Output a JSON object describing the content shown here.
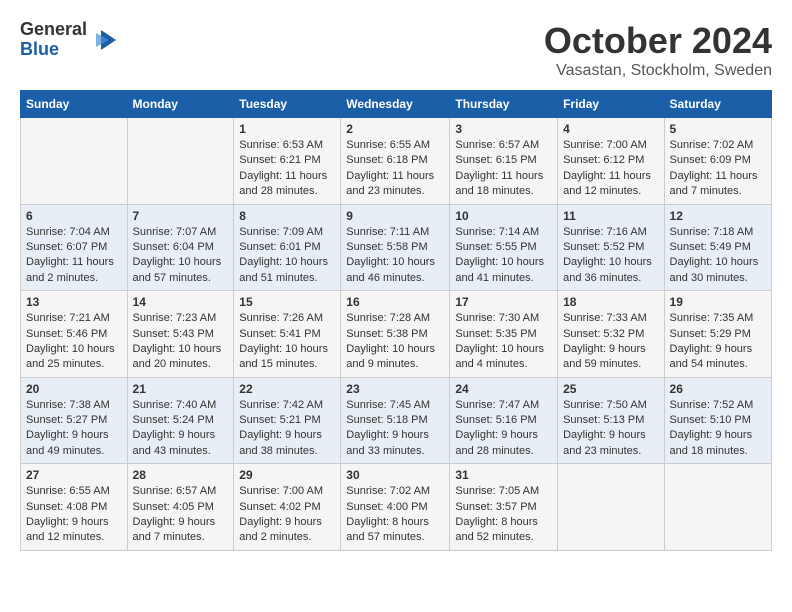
{
  "logo": {
    "general": "General",
    "blue": "Blue"
  },
  "title": "October 2024",
  "location": "Vasastan, Stockholm, Sweden",
  "days_header": [
    "Sunday",
    "Monday",
    "Tuesday",
    "Wednesday",
    "Thursday",
    "Friday",
    "Saturday"
  ],
  "weeks": [
    [
      {
        "day": "",
        "info": ""
      },
      {
        "day": "",
        "info": ""
      },
      {
        "day": "1",
        "sunrise": "Sunrise: 6:53 AM",
        "sunset": "Sunset: 6:21 PM",
        "daylight": "Daylight: 11 hours and 28 minutes."
      },
      {
        "day": "2",
        "sunrise": "Sunrise: 6:55 AM",
        "sunset": "Sunset: 6:18 PM",
        "daylight": "Daylight: 11 hours and 23 minutes."
      },
      {
        "day": "3",
        "sunrise": "Sunrise: 6:57 AM",
        "sunset": "Sunset: 6:15 PM",
        "daylight": "Daylight: 11 hours and 18 minutes."
      },
      {
        "day": "4",
        "sunrise": "Sunrise: 7:00 AM",
        "sunset": "Sunset: 6:12 PM",
        "daylight": "Daylight: 11 hours and 12 minutes."
      },
      {
        "day": "5",
        "sunrise": "Sunrise: 7:02 AM",
        "sunset": "Sunset: 6:09 PM",
        "daylight": "Daylight: 11 hours and 7 minutes."
      }
    ],
    [
      {
        "day": "6",
        "sunrise": "Sunrise: 7:04 AM",
        "sunset": "Sunset: 6:07 PM",
        "daylight": "Daylight: 11 hours and 2 minutes."
      },
      {
        "day": "7",
        "sunrise": "Sunrise: 7:07 AM",
        "sunset": "Sunset: 6:04 PM",
        "daylight": "Daylight: 10 hours and 57 minutes."
      },
      {
        "day": "8",
        "sunrise": "Sunrise: 7:09 AM",
        "sunset": "Sunset: 6:01 PM",
        "daylight": "Daylight: 10 hours and 51 minutes."
      },
      {
        "day": "9",
        "sunrise": "Sunrise: 7:11 AM",
        "sunset": "Sunset: 5:58 PM",
        "daylight": "Daylight: 10 hours and 46 minutes."
      },
      {
        "day": "10",
        "sunrise": "Sunrise: 7:14 AM",
        "sunset": "Sunset: 5:55 PM",
        "daylight": "Daylight: 10 hours and 41 minutes."
      },
      {
        "day": "11",
        "sunrise": "Sunrise: 7:16 AM",
        "sunset": "Sunset: 5:52 PM",
        "daylight": "Daylight: 10 hours and 36 minutes."
      },
      {
        "day": "12",
        "sunrise": "Sunrise: 7:18 AM",
        "sunset": "Sunset: 5:49 PM",
        "daylight": "Daylight: 10 hours and 30 minutes."
      }
    ],
    [
      {
        "day": "13",
        "sunrise": "Sunrise: 7:21 AM",
        "sunset": "Sunset: 5:46 PM",
        "daylight": "Daylight: 10 hours and 25 minutes."
      },
      {
        "day": "14",
        "sunrise": "Sunrise: 7:23 AM",
        "sunset": "Sunset: 5:43 PM",
        "daylight": "Daylight: 10 hours and 20 minutes."
      },
      {
        "day": "15",
        "sunrise": "Sunrise: 7:26 AM",
        "sunset": "Sunset: 5:41 PM",
        "daylight": "Daylight: 10 hours and 15 minutes."
      },
      {
        "day": "16",
        "sunrise": "Sunrise: 7:28 AM",
        "sunset": "Sunset: 5:38 PM",
        "daylight": "Daylight: 10 hours and 9 minutes."
      },
      {
        "day": "17",
        "sunrise": "Sunrise: 7:30 AM",
        "sunset": "Sunset: 5:35 PM",
        "daylight": "Daylight: 10 hours and 4 minutes."
      },
      {
        "day": "18",
        "sunrise": "Sunrise: 7:33 AM",
        "sunset": "Sunset: 5:32 PM",
        "daylight": "Daylight: 9 hours and 59 minutes."
      },
      {
        "day": "19",
        "sunrise": "Sunrise: 7:35 AM",
        "sunset": "Sunset: 5:29 PM",
        "daylight": "Daylight: 9 hours and 54 minutes."
      }
    ],
    [
      {
        "day": "20",
        "sunrise": "Sunrise: 7:38 AM",
        "sunset": "Sunset: 5:27 PM",
        "daylight": "Daylight: 9 hours and 49 minutes."
      },
      {
        "day": "21",
        "sunrise": "Sunrise: 7:40 AM",
        "sunset": "Sunset: 5:24 PM",
        "daylight": "Daylight: 9 hours and 43 minutes."
      },
      {
        "day": "22",
        "sunrise": "Sunrise: 7:42 AM",
        "sunset": "Sunset: 5:21 PM",
        "daylight": "Daylight: 9 hours and 38 minutes."
      },
      {
        "day": "23",
        "sunrise": "Sunrise: 7:45 AM",
        "sunset": "Sunset: 5:18 PM",
        "daylight": "Daylight: 9 hours and 33 minutes."
      },
      {
        "day": "24",
        "sunrise": "Sunrise: 7:47 AM",
        "sunset": "Sunset: 5:16 PM",
        "daylight": "Daylight: 9 hours and 28 minutes."
      },
      {
        "day": "25",
        "sunrise": "Sunrise: 7:50 AM",
        "sunset": "Sunset: 5:13 PM",
        "daylight": "Daylight: 9 hours and 23 minutes."
      },
      {
        "day": "26",
        "sunrise": "Sunrise: 7:52 AM",
        "sunset": "Sunset: 5:10 PM",
        "daylight": "Daylight: 9 hours and 18 minutes."
      }
    ],
    [
      {
        "day": "27",
        "sunrise": "Sunrise: 6:55 AM",
        "sunset": "Sunset: 4:08 PM",
        "daylight": "Daylight: 9 hours and 12 minutes."
      },
      {
        "day": "28",
        "sunrise": "Sunrise: 6:57 AM",
        "sunset": "Sunset: 4:05 PM",
        "daylight": "Daylight: 9 hours and 7 minutes."
      },
      {
        "day": "29",
        "sunrise": "Sunrise: 7:00 AM",
        "sunset": "Sunset: 4:02 PM",
        "daylight": "Daylight: 9 hours and 2 minutes."
      },
      {
        "day": "30",
        "sunrise": "Sunrise: 7:02 AM",
        "sunset": "Sunset: 4:00 PM",
        "daylight": "Daylight: 8 hours and 57 minutes."
      },
      {
        "day": "31",
        "sunrise": "Sunrise: 7:05 AM",
        "sunset": "Sunset: 3:57 PM",
        "daylight": "Daylight: 8 hours and 52 minutes."
      },
      {
        "day": "",
        "info": ""
      },
      {
        "day": "",
        "info": ""
      }
    ]
  ]
}
